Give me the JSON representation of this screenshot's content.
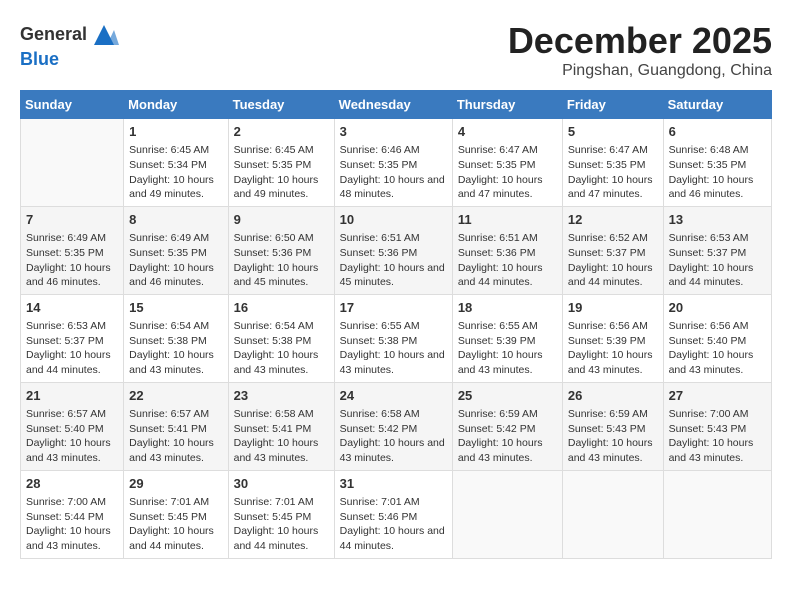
{
  "header": {
    "logo_line1": "General",
    "logo_line2": "Blue",
    "month": "December 2025",
    "location": "Pingshan, Guangdong, China"
  },
  "weekdays": [
    "Sunday",
    "Monday",
    "Tuesday",
    "Wednesday",
    "Thursday",
    "Friday",
    "Saturday"
  ],
  "weeks": [
    [
      {
        "day": "",
        "empty": true
      },
      {
        "day": "1",
        "sunrise": "6:45 AM",
        "sunset": "5:34 PM",
        "daylight": "10 hours and 49 minutes."
      },
      {
        "day": "2",
        "sunrise": "6:45 AM",
        "sunset": "5:35 PM",
        "daylight": "10 hours and 49 minutes."
      },
      {
        "day": "3",
        "sunrise": "6:46 AM",
        "sunset": "5:35 PM",
        "daylight": "10 hours and 48 minutes."
      },
      {
        "day": "4",
        "sunrise": "6:47 AM",
        "sunset": "5:35 PM",
        "daylight": "10 hours and 47 minutes."
      },
      {
        "day": "5",
        "sunrise": "6:47 AM",
        "sunset": "5:35 PM",
        "daylight": "10 hours and 47 minutes."
      },
      {
        "day": "6",
        "sunrise": "6:48 AM",
        "sunset": "5:35 PM",
        "daylight": "10 hours and 46 minutes."
      }
    ],
    [
      {
        "day": "7",
        "sunrise": "6:49 AM",
        "sunset": "5:35 PM",
        "daylight": "10 hours and 46 minutes."
      },
      {
        "day": "8",
        "sunrise": "6:49 AM",
        "sunset": "5:35 PM",
        "daylight": "10 hours and 46 minutes."
      },
      {
        "day": "9",
        "sunrise": "6:50 AM",
        "sunset": "5:36 PM",
        "daylight": "10 hours and 45 minutes."
      },
      {
        "day": "10",
        "sunrise": "6:51 AM",
        "sunset": "5:36 PM",
        "daylight": "10 hours and 45 minutes."
      },
      {
        "day": "11",
        "sunrise": "6:51 AM",
        "sunset": "5:36 PM",
        "daylight": "10 hours and 44 minutes."
      },
      {
        "day": "12",
        "sunrise": "6:52 AM",
        "sunset": "5:37 PM",
        "daylight": "10 hours and 44 minutes."
      },
      {
        "day": "13",
        "sunrise": "6:53 AM",
        "sunset": "5:37 PM",
        "daylight": "10 hours and 44 minutes."
      }
    ],
    [
      {
        "day": "14",
        "sunrise": "6:53 AM",
        "sunset": "5:37 PM",
        "daylight": "10 hours and 44 minutes."
      },
      {
        "day": "15",
        "sunrise": "6:54 AM",
        "sunset": "5:38 PM",
        "daylight": "10 hours and 43 minutes."
      },
      {
        "day": "16",
        "sunrise": "6:54 AM",
        "sunset": "5:38 PM",
        "daylight": "10 hours and 43 minutes."
      },
      {
        "day": "17",
        "sunrise": "6:55 AM",
        "sunset": "5:38 PM",
        "daylight": "10 hours and 43 minutes."
      },
      {
        "day": "18",
        "sunrise": "6:55 AM",
        "sunset": "5:39 PM",
        "daylight": "10 hours and 43 minutes."
      },
      {
        "day": "19",
        "sunrise": "6:56 AM",
        "sunset": "5:39 PM",
        "daylight": "10 hours and 43 minutes."
      },
      {
        "day": "20",
        "sunrise": "6:56 AM",
        "sunset": "5:40 PM",
        "daylight": "10 hours and 43 minutes."
      }
    ],
    [
      {
        "day": "21",
        "sunrise": "6:57 AM",
        "sunset": "5:40 PM",
        "daylight": "10 hours and 43 minutes."
      },
      {
        "day": "22",
        "sunrise": "6:57 AM",
        "sunset": "5:41 PM",
        "daylight": "10 hours and 43 minutes."
      },
      {
        "day": "23",
        "sunrise": "6:58 AM",
        "sunset": "5:41 PM",
        "daylight": "10 hours and 43 minutes."
      },
      {
        "day": "24",
        "sunrise": "6:58 AM",
        "sunset": "5:42 PM",
        "daylight": "10 hours and 43 minutes."
      },
      {
        "day": "25",
        "sunrise": "6:59 AM",
        "sunset": "5:42 PM",
        "daylight": "10 hours and 43 minutes."
      },
      {
        "day": "26",
        "sunrise": "6:59 AM",
        "sunset": "5:43 PM",
        "daylight": "10 hours and 43 minutes."
      },
      {
        "day": "27",
        "sunrise": "7:00 AM",
        "sunset": "5:43 PM",
        "daylight": "10 hours and 43 minutes."
      }
    ],
    [
      {
        "day": "28",
        "sunrise": "7:00 AM",
        "sunset": "5:44 PM",
        "daylight": "10 hours and 43 minutes."
      },
      {
        "day": "29",
        "sunrise": "7:01 AM",
        "sunset": "5:45 PM",
        "daylight": "10 hours and 44 minutes."
      },
      {
        "day": "30",
        "sunrise": "7:01 AM",
        "sunset": "5:45 PM",
        "daylight": "10 hours and 44 minutes."
      },
      {
        "day": "31",
        "sunrise": "7:01 AM",
        "sunset": "5:46 PM",
        "daylight": "10 hours and 44 minutes."
      },
      {
        "day": "",
        "empty": true
      },
      {
        "day": "",
        "empty": true
      },
      {
        "day": "",
        "empty": true
      }
    ]
  ],
  "labels": {
    "sunrise": "Sunrise:",
    "sunset": "Sunset:",
    "daylight": "Daylight:"
  }
}
